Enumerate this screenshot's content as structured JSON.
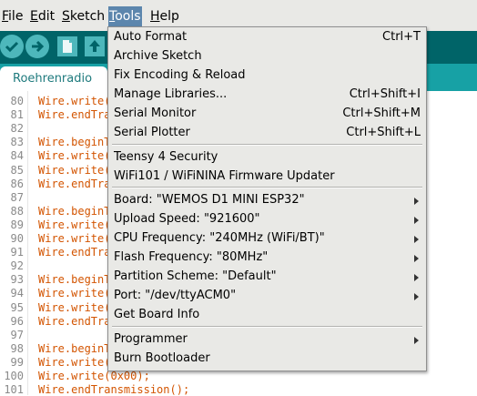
{
  "menubar": {
    "items": [
      {
        "label": "File"
      },
      {
        "label": "Edit"
      },
      {
        "label": "Sketch"
      },
      {
        "label": "Tools"
      },
      {
        "label": "Help"
      }
    ]
  },
  "toolbar": {
    "buttons": [
      "verify-icon",
      "upload-icon",
      "new-icon",
      "open-icon"
    ]
  },
  "tab": {
    "label": "Roehrenradio"
  },
  "editor": {
    "lines": [
      {
        "num": "80",
        "code": "Wire.write("
      },
      {
        "num": "81",
        "code": "Wire.endTra"
      },
      {
        "num": "82",
        "code": ""
      },
      {
        "num": "83",
        "code": "Wire.beginT"
      },
      {
        "num": "84",
        "code": "Wire.write("
      },
      {
        "num": "85",
        "code": "Wire.write("
      },
      {
        "num": "86",
        "code": "Wire.endTra"
      },
      {
        "num": "87",
        "code": ""
      },
      {
        "num": "88",
        "code": "Wire.beginT"
      },
      {
        "num": "89",
        "code": "Wire.write("
      },
      {
        "num": "90",
        "code": "Wire.write("
      },
      {
        "num": "91",
        "code": "Wire.endTra"
      },
      {
        "num": "92",
        "code": ""
      },
      {
        "num": "93",
        "code": "Wire.beginT"
      },
      {
        "num": "94",
        "code": "Wire.write("
      },
      {
        "num": "95",
        "code": "Wire.write("
      },
      {
        "num": "96",
        "code": "Wire.endTra"
      },
      {
        "num": "97",
        "code": ""
      },
      {
        "num": "98",
        "code": "Wire.beginT"
      },
      {
        "num": "99",
        "code": "Wire.write("
      },
      {
        "num": "100",
        "code": "Wire.write(0x00);"
      },
      {
        "num": "101",
        "code": "Wire.endTransmission();"
      }
    ]
  },
  "tools_menu": {
    "items": [
      {
        "label": "Auto Format",
        "shortcut": "Ctrl+T"
      },
      {
        "label": "Archive Sketch",
        "shortcut": ""
      },
      {
        "label": "Fix Encoding & Reload",
        "shortcut": ""
      },
      {
        "label": "Manage Libraries...",
        "shortcut": "Ctrl+Shift+I"
      },
      {
        "label": "Serial Monitor",
        "shortcut": "Ctrl+Shift+M"
      },
      {
        "label": "Serial Plotter",
        "shortcut": "Ctrl+Shift+L"
      },
      {
        "label": "Teensy 4 Security",
        "shortcut": ""
      },
      {
        "label": "WiFi101 / WiFiNINA Firmware Updater",
        "shortcut": ""
      },
      {
        "label": "Board: \"WEMOS D1 MINI ESP32\"",
        "submenu": true
      },
      {
        "label": "Upload Speed: \"921600\"",
        "submenu": true
      },
      {
        "label": "CPU Frequency: \"240MHz (WiFi/BT)\"",
        "submenu": true
      },
      {
        "label": "Flash Frequency: \"80MHz\"",
        "submenu": true
      },
      {
        "label": "Partition Scheme: \"Default\"",
        "submenu": true
      },
      {
        "label": "Port: \"/dev/ttyACM0\"",
        "submenu": true
      },
      {
        "label": "Get Board Info",
        "shortcut": ""
      },
      {
        "label": "Programmer",
        "submenu": true
      },
      {
        "label": "Burn Bootloader",
        "shortcut": ""
      }
    ]
  },
  "colors": {
    "toolbar": "#006468",
    "tabbar": "#17a1a5",
    "menu_highlight": "#5c86ad",
    "keyword": "#d35400"
  }
}
